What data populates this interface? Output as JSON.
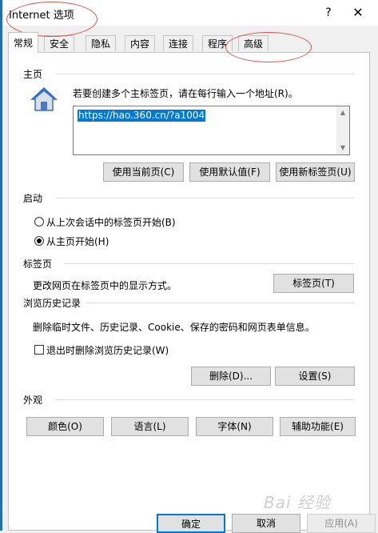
{
  "window": {
    "title": "Internet 选项",
    "help_glyph": "?",
    "close_glyph": "✕"
  },
  "tabs": [
    {
      "label": "常规",
      "active": true
    },
    {
      "label": "安全",
      "active": false
    },
    {
      "label": "隐私",
      "active": false
    },
    {
      "label": "内容",
      "active": false
    },
    {
      "label": "连接",
      "active": false
    },
    {
      "label": "程序",
      "active": false
    },
    {
      "label": "高级",
      "active": false
    }
  ],
  "homepage": {
    "section": "主页",
    "instruction": "若要创建多个主标签页，请在每行输入一个地址(R)。",
    "url": "https://hao.360.cn/?a1004",
    "buttons": {
      "use_current": "使用当前页(C)",
      "use_default": "使用默认值(F)",
      "use_new_tab": "使用新标签页(U)"
    }
  },
  "startup": {
    "section": "启动",
    "options": [
      {
        "label": "从上次会话中的标签页开始(B)",
        "checked": false
      },
      {
        "label": "从主页开始(H)",
        "checked": true
      }
    ]
  },
  "tabs_section": {
    "section": "标签页",
    "description": "更改网页在标签页中的显示方式。",
    "button": "标签页(T)"
  },
  "history": {
    "section": "浏览历史记录",
    "description": "删除临时文件、历史记录、Cookie、保存的密码和网页表单信息。",
    "checkbox_label": "退出时删除浏览历史记录(W)",
    "checkbox_checked": false,
    "delete_button": "删除(D)...",
    "settings_button": "设置(S)"
  },
  "appearance": {
    "section": "外观",
    "buttons": [
      "颜色(O)",
      "语言(L)",
      "字体(N)",
      "辅助功能(E)"
    ]
  },
  "footer": {
    "ok": "确定",
    "cancel": "取消",
    "apply": "应用(A)"
  },
  "watermark": "Bai 经验",
  "colors": {
    "accent": "#0078d7",
    "annotation": "#d9534f"
  }
}
